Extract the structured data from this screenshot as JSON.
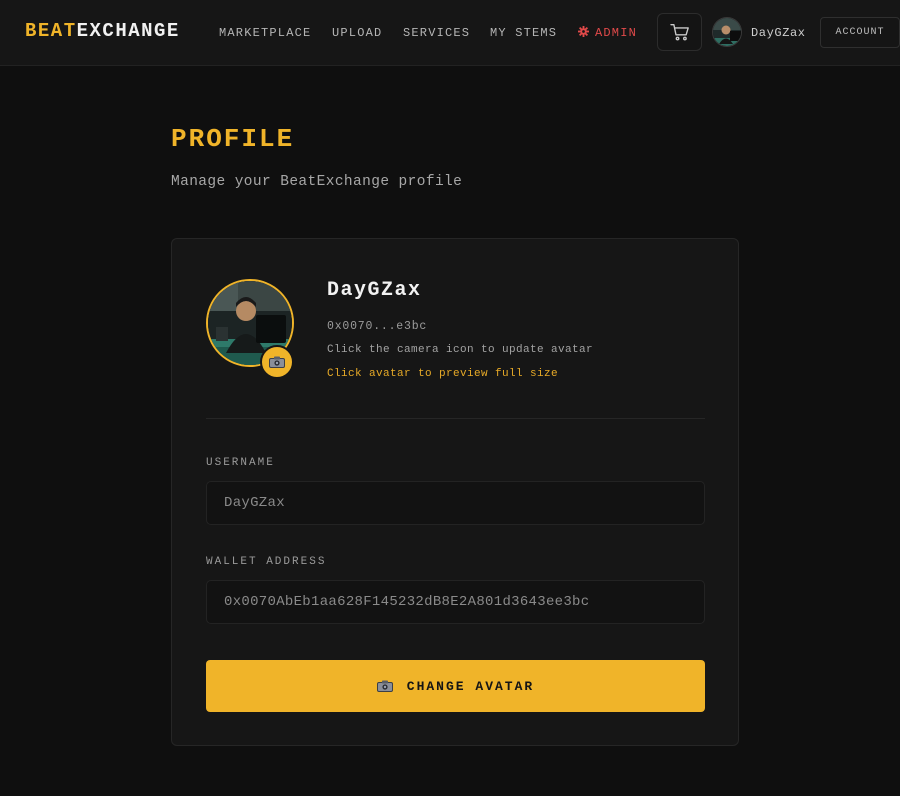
{
  "nav": {
    "logo_part1": "BEAT",
    "logo_part2": "EXCHANGE",
    "links": {
      "marketplace": "MARKETPLACE",
      "upload": "UPLOAD",
      "services": "SERVICES",
      "my_stems": "MY STEMS",
      "admin": "ADMIN"
    },
    "username": "DayGZax",
    "account_label": "ACCOUNT"
  },
  "header": {
    "title": "PROFILE",
    "subtitle": "Manage your BeatExchange profile"
  },
  "profile": {
    "name": "DayGZax",
    "short_address": "0x0070...e3bc",
    "hint": "Click the camera icon to update avatar",
    "preview_hint": "Click avatar to preview full size"
  },
  "form": {
    "username_label": "USERNAME",
    "username_value": "DayGZax",
    "wallet_label": "WALLET ADDRESS",
    "wallet_value": "0x0070AbEb1aa628F145232dB8E2A801d3643ee3bc"
  },
  "actions": {
    "change_avatar_label": "CHANGE AVATAR"
  },
  "icons": {
    "admin": "gear-icon",
    "cart": "cart-icon",
    "camera": "camera-icon"
  },
  "colors": {
    "accent": "#f0b429",
    "admin": "#e24a4a",
    "background": "#0f0f0f",
    "card": "#161616"
  }
}
